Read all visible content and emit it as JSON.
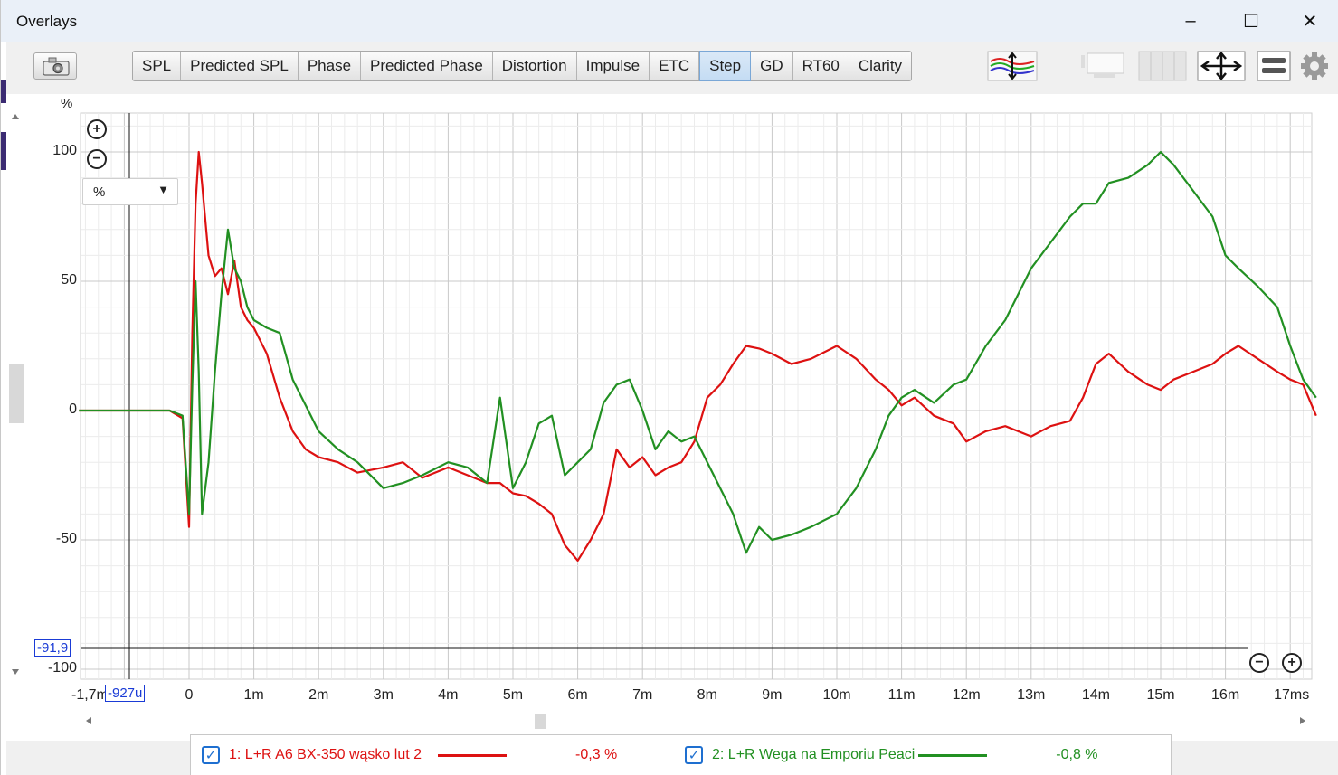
{
  "window": {
    "title": "Overlays",
    "minimize": "–",
    "maximize": "☐",
    "close": "✕"
  },
  "toolbar": {
    "camera_icon": "camera-icon",
    "tabs": [
      {
        "label": "SPL"
      },
      {
        "label": "Predicted SPL"
      },
      {
        "label": "Phase"
      },
      {
        "label": "Predicted Phase"
      },
      {
        "label": "Distortion"
      },
      {
        "label": "Impulse"
      },
      {
        "label": "ETC"
      },
      {
        "label": "Step"
      },
      {
        "label": "GD"
      },
      {
        "label": "RT60"
      },
      {
        "label": "Clarity"
      }
    ],
    "active_tab": "Step",
    "icons": [
      "trace-arrange-icon",
      "single-view-icon",
      "multi-view-icon",
      "zoom-fit-icon",
      "controls-icon",
      "gear-icon"
    ]
  },
  "plot": {
    "y_unit": "%",
    "unit_select": "%",
    "y_cursor": "-91,9",
    "x_cursor": "-927u"
  },
  "chart_data": {
    "type": "line",
    "ylabel": "%",
    "yticks": [
      "100",
      "50",
      "0",
      "-50",
      "-100"
    ],
    "xticks": [
      "-1,7m",
      "0",
      "1m",
      "2m",
      "3m",
      "4m",
      "5m",
      "6m",
      "7m",
      "8m",
      "9m",
      "10m",
      "11m",
      "12m",
      "13m",
      "14m",
      "15m",
      "16m",
      "17ms"
    ],
    "xlim": [
      -1.7,
      17.4
    ],
    "ylim": [
      -105,
      115
    ],
    "x": [
      -1.7,
      -1.0,
      -0.3,
      -0.1,
      0.0,
      0.05,
      0.1,
      0.15,
      0.2,
      0.3,
      0.4,
      0.5,
      0.6,
      0.7,
      0.8,
      0.9,
      1.0,
      1.2,
      1.4,
      1.6,
      1.8,
      2.0,
      2.3,
      2.6,
      3.0,
      3.3,
      3.6,
      4.0,
      4.3,
      4.6,
      4.8,
      5.0,
      5.2,
      5.4,
      5.6,
      5.8,
      6.0,
      6.2,
      6.4,
      6.6,
      6.8,
      7.0,
      7.2,
      7.4,
      7.6,
      7.8,
      8.0,
      8.2,
      8.4,
      8.6,
      8.8,
      9.0,
      9.3,
      9.6,
      10.0,
      10.3,
      10.6,
      10.8,
      11.0,
      11.2,
      11.5,
      11.8,
      12.0,
      12.3,
      12.6,
      13.0,
      13.3,
      13.6,
      13.8,
      14.0,
      14.2,
      14.5,
      14.8,
      15.0,
      15.2,
      15.5,
      15.8,
      16.0,
      16.2,
      16.5,
      16.8,
      17.0,
      17.2,
      17.4
    ],
    "series": [
      {
        "name": "1: L+R A6 BX-350 wąsko lut 2",
        "color": "#dd1111",
        "values": [
          0,
          0,
          0,
          -3,
          -45,
          30,
          80,
          100,
          88,
          60,
          52,
          55,
          45,
          58,
          40,
          35,
          32,
          22,
          5,
          -8,
          -15,
          -18,
          -20,
          -24,
          -22,
          -20,
          -26,
          -22,
          -25,
          -28,
          -28,
          -32,
          -33,
          -36,
          -40,
          -52,
          -58,
          -50,
          -40,
          -15,
          -22,
          -18,
          -25,
          -22,
          -20,
          -12,
          5,
          10,
          18,
          25,
          24,
          22,
          18,
          20,
          25,
          20,
          12,
          8,
          2,
          5,
          -2,
          -5,
          -12,
          -8,
          -6,
          -10,
          -6,
          -4,
          5,
          18,
          22,
          15,
          10,
          8,
          12,
          15,
          18,
          22,
          25,
          20,
          15,
          12,
          10,
          -2
        ]
      },
      {
        "name": "2: L+R Wega na Emporiu Peaci",
        "color": "#229022",
        "values": [
          0,
          0,
          0,
          -2,
          -40,
          10,
          50,
          15,
          -40,
          -20,
          15,
          45,
          70,
          55,
          50,
          40,
          35,
          32,
          30,
          12,
          2,
          -8,
          -15,
          -20,
          -30,
          -28,
          -25,
          -20,
          -22,
          -28,
          5,
          -30,
          -20,
          -5,
          -2,
          -25,
          -20,
          -15,
          3,
          10,
          12,
          0,
          -15,
          -8,
          -12,
          -10,
          -20,
          -30,
          -40,
          -55,
          -45,
          -50,
          -48,
          -45,
          -40,
          -30,
          -15,
          -2,
          5,
          8,
          3,
          10,
          12,
          25,
          35,
          55,
          65,
          75,
          80,
          80,
          88,
          90,
          95,
          100,
          95,
          85,
          75,
          60,
          55,
          48,
          40,
          25,
          12,
          5
        ]
      }
    ]
  },
  "legend": [
    {
      "checked": "✓",
      "label": "1: L+R A6 BX-350 wąsko lut 2",
      "value": "-0,3 %",
      "color": "#dd1111"
    },
    {
      "checked": "✓",
      "label": "2: L+R Wega na Emporiu Peaci",
      "value": "-0,8 %",
      "color": "#229022"
    }
  ]
}
